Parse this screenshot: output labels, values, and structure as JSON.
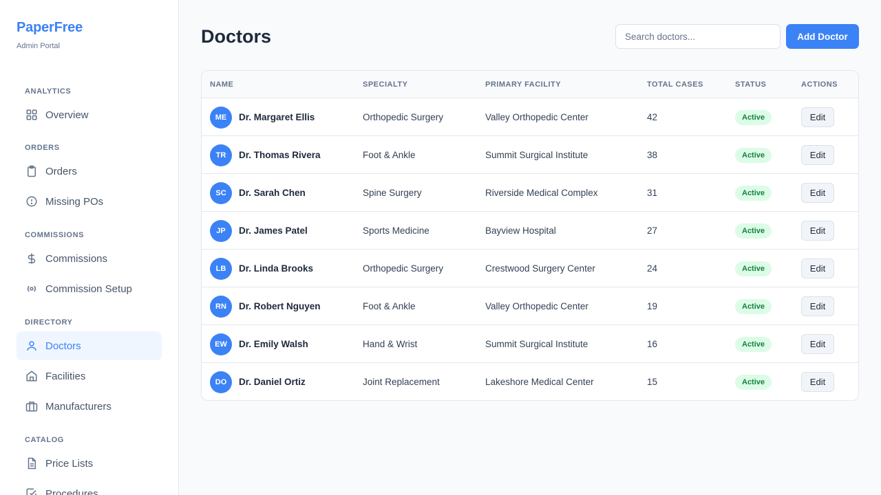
{
  "brand": {
    "name": "PaperFree",
    "subtitle": "Admin Portal"
  },
  "sidebar": {
    "sections": [
      {
        "label": "ANALYTICS",
        "items": [
          {
            "label": "Overview",
            "icon": "grid-icon"
          }
        ]
      },
      {
        "label": "ORDERS",
        "items": [
          {
            "label": "Orders",
            "icon": "clipboard-icon"
          },
          {
            "label": "Missing POs",
            "icon": "alert-circle-icon"
          }
        ]
      },
      {
        "label": "COMMISSIONS",
        "items": [
          {
            "label": "Commissions",
            "icon": "dollar-icon"
          },
          {
            "label": "Commission Setup",
            "icon": "settings-broadcast-icon"
          }
        ]
      },
      {
        "label": "DIRECTORY",
        "items": [
          {
            "label": "Doctors",
            "icon": "user-icon",
            "active": true
          },
          {
            "label": "Facilities",
            "icon": "home-icon"
          },
          {
            "label": "Manufacturers",
            "icon": "briefcase-icon"
          }
        ]
      },
      {
        "label": "CATALOG",
        "items": [
          {
            "label": "Price Lists",
            "icon": "file-text-icon"
          },
          {
            "label": "Procedures",
            "icon": "check-square-icon"
          }
        ]
      }
    ]
  },
  "header": {
    "title": "Doctors",
    "search_placeholder": "Search doctors...",
    "search_value": "",
    "add_button_label": "Add Doctor"
  },
  "table": {
    "columns": [
      "NAME",
      "SPECIALTY",
      "PRIMARY FACILITY",
      "TOTAL CASES",
      "STATUS",
      "ACTIONS"
    ],
    "edit_label": "Edit",
    "rows": [
      {
        "initials": "ME",
        "name": "Dr. Margaret Ellis",
        "specialty": "Orthopedic Surgery",
        "facility": "Valley Orthopedic Center",
        "cases": "42",
        "status": "Active"
      },
      {
        "initials": "TR",
        "name": "Dr. Thomas Rivera",
        "specialty": "Foot & Ankle",
        "facility": "Summit Surgical Institute",
        "cases": "38",
        "status": "Active"
      },
      {
        "initials": "SC",
        "name": "Dr. Sarah Chen",
        "specialty": "Spine Surgery",
        "facility": "Riverside Medical Complex",
        "cases": "31",
        "status": "Active"
      },
      {
        "initials": "JP",
        "name": "Dr. James Patel",
        "specialty": "Sports Medicine",
        "facility": "Bayview Hospital",
        "cases": "27",
        "status": "Active"
      },
      {
        "initials": "LB",
        "name": "Dr. Linda Brooks",
        "specialty": "Orthopedic Surgery",
        "facility": "Crestwood Surgery Center",
        "cases": "24",
        "status": "Active"
      },
      {
        "initials": "RN",
        "name": "Dr. Robert Nguyen",
        "specialty": "Foot & Ankle",
        "facility": "Valley Orthopedic Center",
        "cases": "19",
        "status": "Active"
      },
      {
        "initials": "EW",
        "name": "Dr. Emily Walsh",
        "specialty": "Hand & Wrist",
        "facility": "Summit Surgical Institute",
        "cases": "16",
        "status": "Active"
      },
      {
        "initials": "DO",
        "name": "Dr. Daniel Ortiz",
        "specialty": "Joint Replacement",
        "facility": "Lakeshore Medical Center",
        "cases": "15",
        "status": "Active"
      }
    ]
  },
  "colors": {
    "accent": "#3b82f6",
    "active_nav_bg": "#eff6ff",
    "status_active_bg": "#dcfce7",
    "status_active_text": "#15803d"
  }
}
